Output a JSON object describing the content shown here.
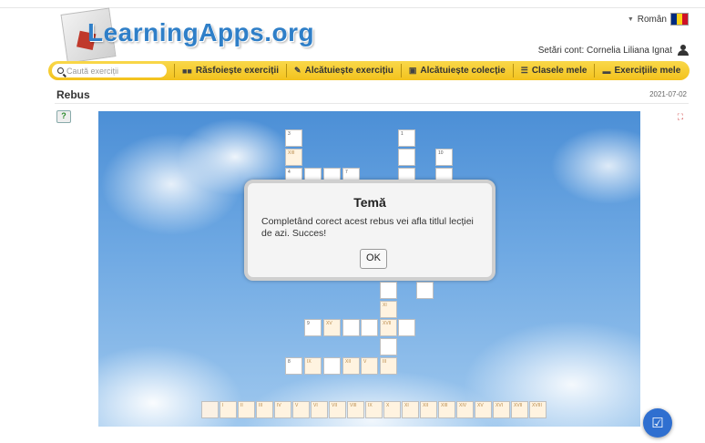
{
  "header": {
    "logo_text": "LearningApps.org",
    "language": "Român",
    "language_flag": [
      "#002b7f",
      "#fcd116",
      "#ce1126"
    ],
    "account_label": "Setări cont: Cornelia Liliana Ignat"
  },
  "nav": {
    "search_placeholder": "Caută exerciții",
    "items": [
      {
        "icon": "grid-icon",
        "label": "Răsfoiește exerciții"
      },
      {
        "icon": "pencil-icon",
        "label": "Alcătuiește exercițiu"
      },
      {
        "icon": "collection-icon",
        "label": "Alcătuiește colecție"
      },
      {
        "icon": "list-icon",
        "label": "Clasele mele"
      },
      {
        "icon": "folder-icon",
        "label": "Exercițiile mele"
      }
    ]
  },
  "page": {
    "title": "Rebus",
    "date": "2021-07-02"
  },
  "crossword": {
    "numbers": [
      "1",
      "3",
      "4",
      "7",
      "9",
      "10",
      "8"
    ],
    "bottom_labels": [
      "I",
      "II",
      "III",
      "IV",
      "V",
      "VI",
      "VII",
      "VIII",
      "IX",
      "X",
      "XI",
      "XII",
      "XIII",
      "XIV",
      "XV",
      "XVI",
      "XVII",
      "XVIII"
    ],
    "cell_labels": [
      "XIII",
      "XI",
      "XV",
      "XVII",
      "IX",
      "XII",
      "V",
      "III"
    ]
  },
  "dialog": {
    "title": "Temă",
    "text": "Completând corect acest rebus vei afla titlul lecției de azi. Succes!",
    "ok_label": "OK"
  },
  "colors": {
    "nav_yellow": "#f3c21d",
    "logo_blue": "#2f7fc8",
    "fab_blue": "#2f6fd0"
  }
}
